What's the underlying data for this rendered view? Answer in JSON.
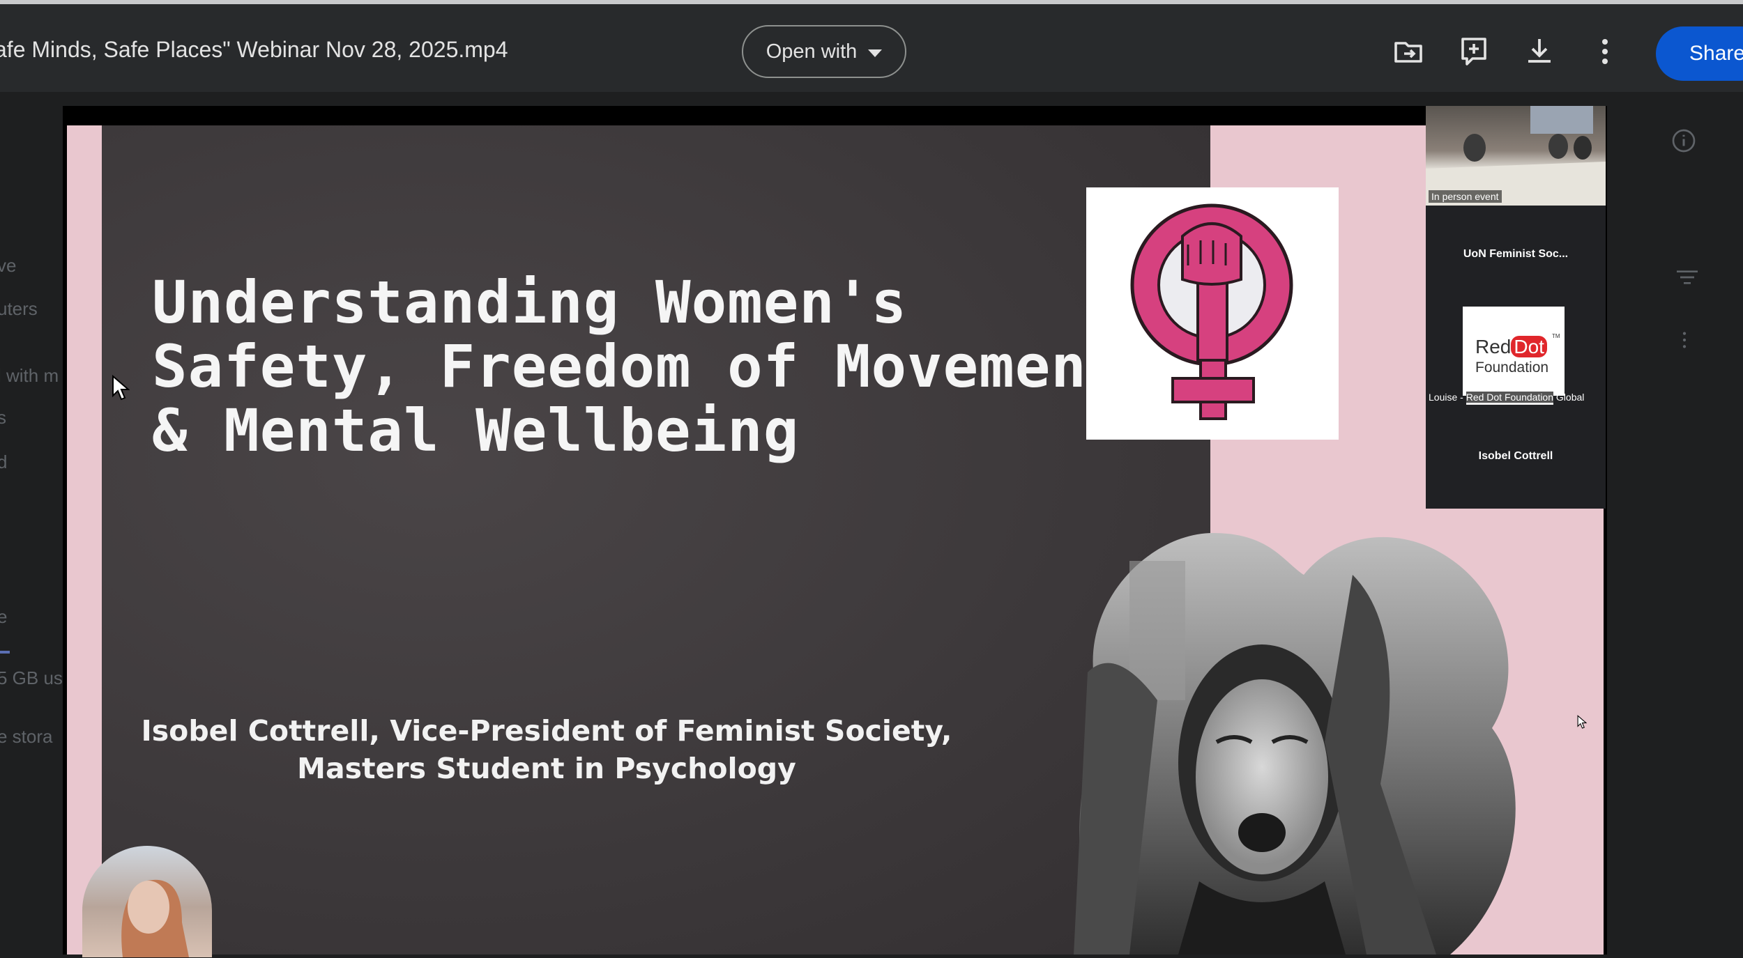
{
  "header": {
    "file_title": "afe Minds, Safe Places\" Webinar Nov 28, 2025.mp4",
    "open_with_label": "Open with",
    "share_label": "Share",
    "icons": [
      "move-to-folder-icon",
      "add-to-drive-icon",
      "download-icon",
      "more-vert-icon"
    ]
  },
  "background_ui": {
    "items": [
      "ve",
      "uters",
      "l with m",
      "s",
      "d",
      "e",
      "5 GB us",
      "e stora"
    ]
  },
  "slide": {
    "title": "Understanding Women's Safety, Freedom of Movement & Mental Wellbeing",
    "subtitle_line1": "Isobel Cottrell, Vice-President of Feminist Society,",
    "subtitle_line2": "Masters Student in Psychology"
  },
  "participants": {
    "tile1_caption": "In person event",
    "tile2_name": "UoN Feminist Soc...",
    "tile3_logo_red": "Red",
    "tile3_logo_dot": "Dot",
    "tile3_logo_tm": "TM",
    "tile3_logo_foundation": "Foundation",
    "tile3_name_prefix": "Louise - ",
    "tile3_name_mid": "Red Dot Foundation",
    "tile3_name_suffix": " Global",
    "tile4_name": "Isobel Cottrell"
  },
  "colors": {
    "topbar": "#282a2c",
    "share": "#0b57d0",
    "slide_pink": "#e9c7cf",
    "slide_dark": "#3c383a",
    "symbol_pink": "#d6417f"
  }
}
